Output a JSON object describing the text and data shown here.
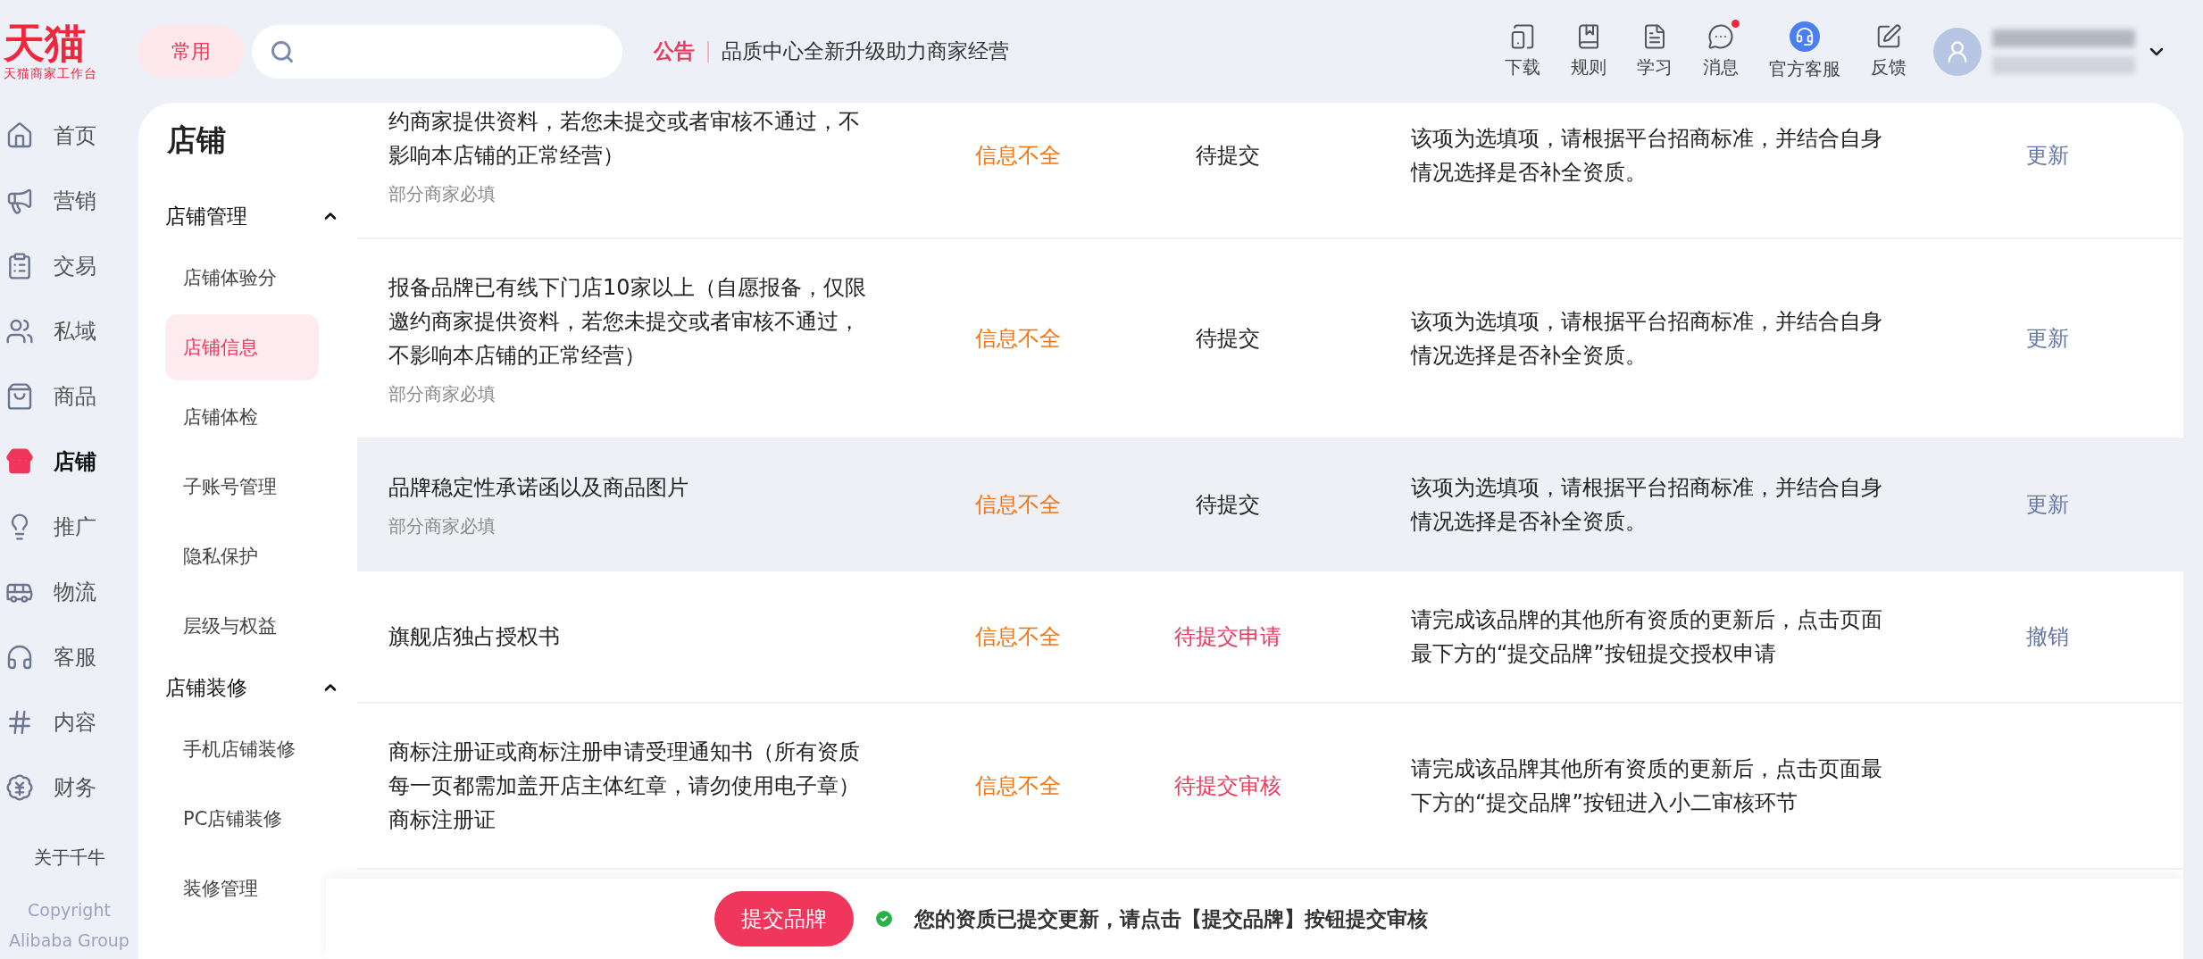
{
  "header": {
    "logo": "天猫",
    "logo_subtitle": "天猫商家工作台",
    "frequent_button": "常用",
    "notice_label": "公告",
    "notice_text": "品质中心全新升级助力商家经营",
    "tools": [
      {
        "label": "下载",
        "badge": false
      },
      {
        "label": "规则",
        "badge": false
      },
      {
        "label": "学习",
        "badge": false
      },
      {
        "label": "消息",
        "badge": true
      },
      {
        "label": "官方客服",
        "badge": false
      },
      {
        "label": "反馈",
        "badge": false
      }
    ]
  },
  "nav": {
    "items": [
      {
        "label": "首页",
        "selected": false
      },
      {
        "label": "营销",
        "selected": false
      },
      {
        "label": "交易",
        "selected": false
      },
      {
        "label": "私域",
        "selected": false
      },
      {
        "label": "商品",
        "selected": false
      },
      {
        "label": "店铺",
        "selected": true
      },
      {
        "label": "推广",
        "selected": false
      },
      {
        "label": "物流",
        "selected": false
      },
      {
        "label": "客服",
        "selected": false
      },
      {
        "label": "内容",
        "selected": false
      },
      {
        "label": "财务",
        "selected": false
      }
    ],
    "about": "关于千牛",
    "copyright": "Copyright",
    "company": "Alibaba Group"
  },
  "submenu": {
    "title": "店铺",
    "groups": [
      {
        "label": "店铺管理",
        "expanded": true,
        "items": [
          {
            "label": "店铺体验分",
            "selected": false
          },
          {
            "label": "店铺信息",
            "selected": true
          },
          {
            "label": "店铺体检",
            "selected": false
          },
          {
            "label": "子账号管理",
            "selected": false
          },
          {
            "label": "隐私保护",
            "selected": false
          },
          {
            "label": "层级与权益",
            "selected": false
          }
        ]
      },
      {
        "label": "店铺装修",
        "expanded": true,
        "items": [
          {
            "label": "手机店铺装修",
            "selected": false
          },
          {
            "label": "PC店铺装修",
            "selected": false
          },
          {
            "label": "装修管理",
            "selected": false
          }
        ]
      }
    ]
  },
  "table": {
    "rows": [
      {
        "name": "约商家提供资料，若您未提交或者审核不通过，不影响本店铺的正常经营）",
        "note": "部分商家必填",
        "info": "信息不全",
        "status": "待提交",
        "alert": false,
        "description": "该项为选填项，请根据平台招商标准，并结合自身情况选择是否补全资质。",
        "action": "更新",
        "highlighted": false
      },
      {
        "name": "报备品牌已有线下门店10家以上（自愿报备，仅限邀约商家提供资料，若您未提交或者审核不通过，不影响本店铺的正常经营）",
        "note": "部分商家必填",
        "info": "信息不全",
        "status": "待提交",
        "alert": false,
        "description": "该项为选填项，请根据平台招商标准，并结合自身情况选择是否补全资质。",
        "action": "更新",
        "highlighted": false
      },
      {
        "name": "品牌稳定性承诺函以及商品图片",
        "note": "部分商家必填",
        "info": "信息不全",
        "status": "待提交",
        "alert": false,
        "description": "该项为选填项，请根据平台招商标准，并结合自身情况选择是否补全资质。",
        "action": "更新",
        "highlighted": true
      },
      {
        "name": "旗舰店独占授权书",
        "info": "信息不全",
        "status": "待提交申请",
        "alert": true,
        "description": "请完成该品牌的其他所有资质的更新后，点击页面最下方的“提交品牌”按钮提交授权申请",
        "action": "撤销",
        "highlighted": false
      },
      {
        "name": "商标注册证或商标注册申请受理通知书（所有资质每一页都需加盖开店主体红章，请勿使用电子章）商标注册证",
        "info": "信息不全",
        "status": "待提交审核",
        "alert": true,
        "description": "请完成该品牌其他所有资质的更新后，点击页面最下方的“提交品牌”按钮进入小二审核环节",
        "highlighted": false
      }
    ]
  },
  "footer": {
    "submit_button": "提交品牌",
    "message": "您的资质已提交更新，请点击【提交品牌】按钮提交审核"
  }
}
